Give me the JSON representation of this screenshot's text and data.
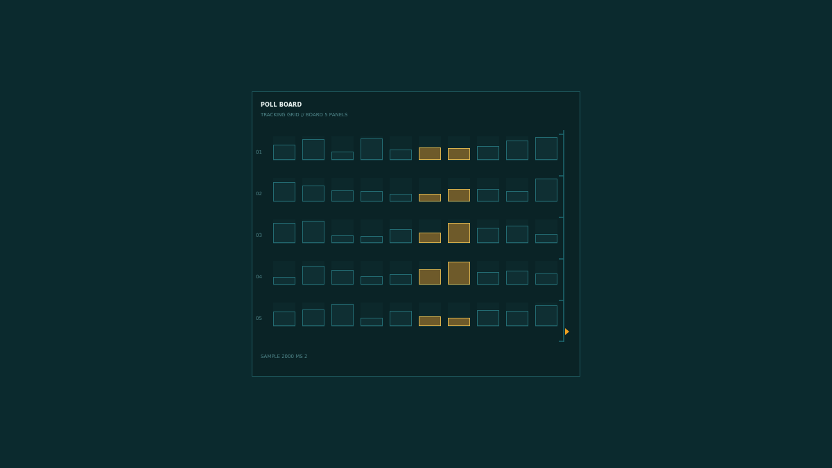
{
  "title": "POLL BOARD",
  "subtitle": "TRACKING GRID // BOARD 5 PANELS",
  "rows": [
    {
      "label": "01",
      "bars": [
        {
          "level": 0.65,
          "highlighted": false
        },
        {
          "level": 0.88,
          "highlighted": false
        },
        {
          "level": 0.35,
          "highlighted": false
        },
        {
          "level": 0.91,
          "highlighted": false
        },
        {
          "level": 0.44,
          "highlighted": false
        },
        {
          "level": 0.53,
          "highlighted": true
        },
        {
          "level": 0.5,
          "highlighted": true
        },
        {
          "level": 0.59,
          "highlighted": false
        },
        {
          "level": 0.82,
          "highlighted": false
        },
        {
          "level": 0.97,
          "highlighted": false
        }
      ]
    },
    {
      "label": "02",
      "bars": [
        {
          "level": 0.82,
          "highlighted": false
        },
        {
          "level": 0.68,
          "highlighted": false
        },
        {
          "level": 0.47,
          "highlighted": false
        },
        {
          "level": 0.44,
          "highlighted": false
        },
        {
          "level": 0.32,
          "highlighted": false
        },
        {
          "level": 0.32,
          "highlighted": true
        },
        {
          "level": 0.53,
          "highlighted": true
        },
        {
          "level": 0.53,
          "highlighted": false
        },
        {
          "level": 0.44,
          "highlighted": false
        },
        {
          "level": 0.97,
          "highlighted": false
        }
      ]
    },
    {
      "label": "03",
      "bars": [
        {
          "level": 0.85,
          "highlighted": false
        },
        {
          "level": 0.94,
          "highlighted": false
        },
        {
          "level": 0.32,
          "highlighted": false
        },
        {
          "level": 0.29,
          "highlighted": false
        },
        {
          "level": 0.59,
          "highlighted": false
        },
        {
          "level": 0.44,
          "highlighted": true
        },
        {
          "level": 0.85,
          "highlighted": true
        },
        {
          "level": 0.65,
          "highlighted": false
        },
        {
          "level": 0.74,
          "highlighted": false
        },
        {
          "level": 0.38,
          "highlighted": false
        }
      ]
    },
    {
      "label": "04",
      "bars": [
        {
          "level": 0.32,
          "highlighted": false
        },
        {
          "level": 0.79,
          "highlighted": false
        },
        {
          "level": 0.62,
          "highlighted": false
        },
        {
          "level": 0.35,
          "highlighted": false
        },
        {
          "level": 0.44,
          "highlighted": false
        },
        {
          "level": 0.65,
          "highlighted": true
        },
        {
          "level": 0.97,
          "highlighted": true
        },
        {
          "level": 0.53,
          "highlighted": false
        },
        {
          "level": 0.59,
          "highlighted": false
        },
        {
          "level": 0.47,
          "highlighted": false
        }
      ]
    },
    {
      "label": "05",
      "bars": [
        {
          "level": 0.62,
          "highlighted": false
        },
        {
          "level": 0.71,
          "highlighted": false
        },
        {
          "level": 0.94,
          "highlighted": false
        },
        {
          "level": 0.35,
          "highlighted": false
        },
        {
          "level": 0.65,
          "highlighted": false
        },
        {
          "level": 0.41,
          "highlighted": true
        },
        {
          "level": 0.35,
          "highlighted": true
        },
        {
          "level": 0.68,
          "highlighted": false
        },
        {
          "level": 0.65,
          "highlighted": false
        },
        {
          "level": 0.88,
          "highlighted": false
        }
      ]
    }
  ],
  "scale": {
    "level": 0.95
  },
  "footer": "SAMPLE 2000 MS 2"
}
